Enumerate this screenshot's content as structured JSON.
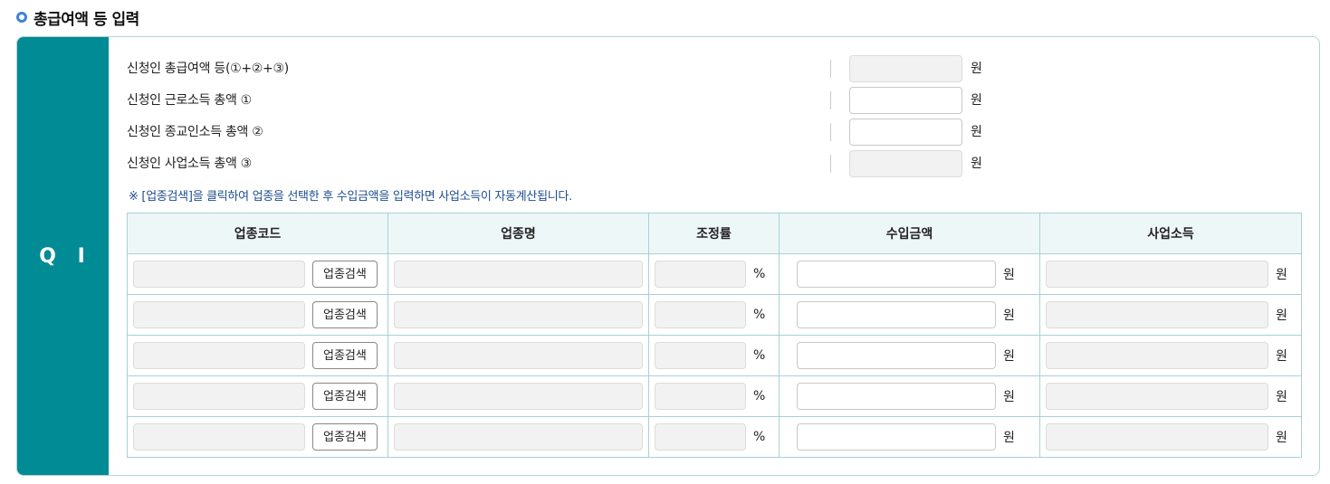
{
  "section": {
    "title": "총급여액 등 입력"
  },
  "panel": {
    "side_label": "Q I"
  },
  "summary": [
    {
      "label": "신청인 총급여액 등(①+②+③)",
      "value": "",
      "unit": "원",
      "readonly": true
    },
    {
      "label": "신청인 근로소득 총액 ①",
      "value": "",
      "unit": "원",
      "readonly": false
    },
    {
      "label": "신청인 종교인소득 총액 ②",
      "value": "",
      "unit": "원",
      "readonly": false
    },
    {
      "label": "신청인 사업소득 총액 ③",
      "value": "",
      "unit": "원",
      "readonly": true
    }
  ],
  "notice": "※ [업종검색]을 클릭하여 업종을 선택한 후 수입금액을 입력하면 사업소득이 자동계산됩니다.",
  "table": {
    "headers": [
      "업종코드",
      "업종명",
      "조정률",
      "수입금액",
      "사업소득"
    ],
    "search_button_label": "업종검색",
    "percent_unit": "%",
    "won_unit": "원",
    "rows": [
      {
        "code": "",
        "name": "",
        "rate": "",
        "income": "",
        "business_income": ""
      },
      {
        "code": "",
        "name": "",
        "rate": "",
        "income": "",
        "business_income": ""
      },
      {
        "code": "",
        "name": "",
        "rate": "",
        "income": "",
        "business_income": ""
      },
      {
        "code": "",
        "name": "",
        "rate": "",
        "income": "",
        "business_income": ""
      },
      {
        "code": "",
        "name": "",
        "rate": "",
        "income": "",
        "business_income": ""
      }
    ]
  },
  "colors": {
    "accent": "#008b95",
    "bullet": "#3f83d6",
    "header_bg": "#eef7f8",
    "notice": "#1d4e8f"
  }
}
